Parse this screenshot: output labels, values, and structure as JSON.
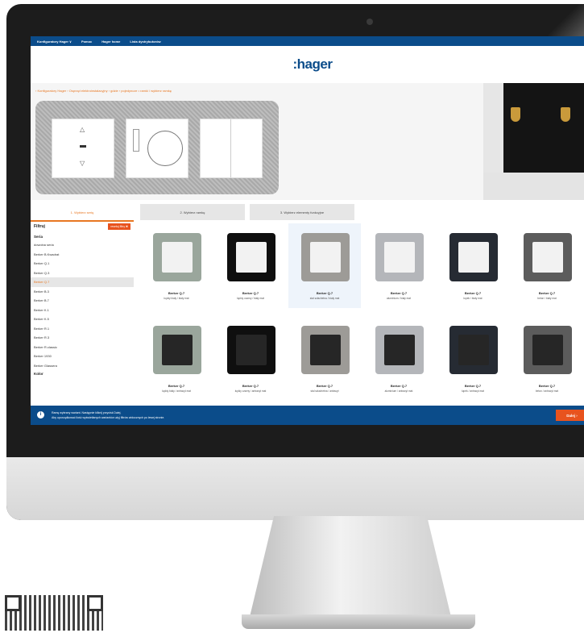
{
  "nav": {
    "items": [
      "Konfiguratory Hager  ∨",
      "Pomoc",
      "Hager home",
      "Lista dystrybutorów"
    ]
  },
  "brand": {
    "logo": ":hager"
  },
  "breadcrumb": "›  Konfiguratory Hager  ›  Osprzęt elektroinstalacyjny  ›  gdzie  ›  pojedyncze • ramki / wybierz ramkę",
  "tabs": [
    "1. Wybierz serię",
    "2. Wybierz ramkę",
    "3. Wybierz elementy funkcyjne"
  ],
  "filters": {
    "title": "Filtruj",
    "reset": "resetuj filtry ✖",
    "section_series": "Seria",
    "series": [
      "dowolna seria",
      "Berker B.Kwadrat",
      "Berker Q.1",
      "Berker Q.3",
      "Berker Q.7",
      "Berker B.3",
      "Berker B.7",
      "Berker K.1",
      "Berker K.5",
      "Berker R.1",
      "Berker R.3",
      "Berker R.classic",
      "Berker 1930",
      "Berker Glassera"
    ],
    "selected": "Berker Q.7",
    "section_color": "Kolor"
  },
  "cards": [
    {
      "name": "Berker Q.7",
      "desc": "łupkiy biały / biały mat",
      "frame": "#9aa69c",
      "insert": "#f2f2f2"
    },
    {
      "name": "Berker Q.7",
      "desc": "łupkiy czarny / biały mat",
      "frame": "#0f0f0f",
      "insert": "#f2f2f2"
    },
    {
      "name": "Berker Q.7",
      "desc": "stal szlachetna / biały mat",
      "frame": "#9d9b97",
      "insert": "#f2f2f2"
    },
    {
      "name": "Berker Q.7",
      "desc": "aluminium / biały mat",
      "frame": "#b4b6ba",
      "insert": "#f2f2f2"
    },
    {
      "name": "Berker Q.7",
      "desc": "łupek / biały mat",
      "frame": "#262b33",
      "insert": "#f2f2f2"
    },
    {
      "name": "Berker Q.7",
      "desc": "beton / biały mat",
      "frame": "#5c5c5c",
      "insert": "#f2f2f2"
    },
    {
      "name": "Berker Q.7",
      "desc": "łupkiy biały / antracyt mat",
      "frame": "#9aa69c",
      "insert": "#262626"
    },
    {
      "name": "Berker Q.7",
      "desc": "łupkiy czarny / antracyt mat",
      "frame": "#0f0f0f",
      "insert": "#262626"
    },
    {
      "name": "Berker Q.7",
      "desc": "stal szlachetna / antracyt",
      "frame": "#9d9b97",
      "insert": "#262626"
    },
    {
      "name": "Berker Q.7",
      "desc": "aluminium / antracyt mat",
      "frame": "#b4b6ba",
      "insert": "#262626"
    },
    {
      "name": "Berker Q.7",
      "desc": "łupek / antracyt mat",
      "frame": "#262b33",
      "insert": "#262626"
    },
    {
      "name": "Berker Q.7",
      "desc": "beton / antracyt mat",
      "frame": "#5c5c5c",
      "insert": "#262626"
    }
  ],
  "banner": {
    "line1": "Ramę wybrany wariant. Następnie kliknij przycisk Dalej.",
    "line2": "Aby uporządkować ilość wyświetlanych wariantów użyj filtrów widocznych po lewej stronie.",
    "button": "Dalej ›"
  },
  "colors": {
    "brand": "#0b4c8a",
    "accent": "#e8531e",
    "crumb": "#e87722"
  }
}
